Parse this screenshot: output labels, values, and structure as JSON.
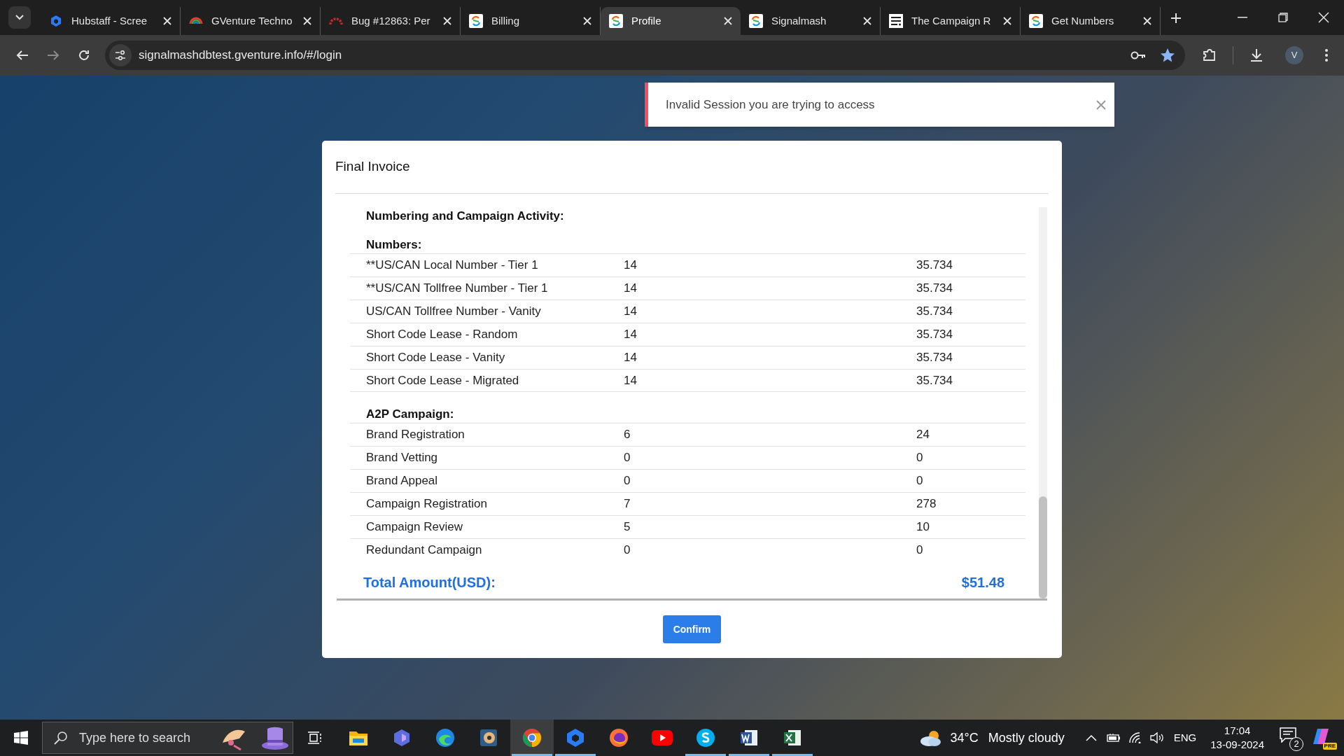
{
  "browser": {
    "tabs": [
      {
        "title": "Hubstaff - Scree",
        "selected": false
      },
      {
        "title": "GVenture Techno",
        "selected": false
      },
      {
        "title": "Bug #12863: Per",
        "selected": false
      },
      {
        "title": "Billing",
        "selected": false
      },
      {
        "title": "Profile",
        "selected": true
      },
      {
        "title": "Signalmash",
        "selected": false
      },
      {
        "title": "The Campaign R",
        "selected": false
      },
      {
        "title": "Get Numbers",
        "selected": false
      }
    ],
    "address": "signalmashdbtest.gventure.info/#/login",
    "bookmarked": true,
    "profile_initial": "V"
  },
  "toast": {
    "message": "Invalid Session you are trying to access"
  },
  "modal": {
    "title": "Final Invoice",
    "heading": "Numbering and Campaign Activity:",
    "sections": [
      {
        "title": "Numbers:",
        "rows": [
          [
            "**US/CAN Local Number - Tier 1",
            "14",
            "35.734"
          ],
          [
            "**US/CAN Tollfree Number - Tier 1",
            "14",
            "35.734"
          ],
          [
            "US/CAN Tollfree Number - Vanity",
            "14",
            "35.734"
          ],
          [
            "Short Code Lease - Random",
            "14",
            "35.734"
          ],
          [
            "Short Code Lease - Vanity",
            "14",
            "35.734"
          ],
          [
            "Short Code Lease - Migrated",
            "14",
            "35.734"
          ]
        ]
      },
      {
        "title": "A2P Campaign:",
        "rows": [
          [
            "Brand Registration",
            "6",
            "24"
          ],
          [
            "Brand Vetting",
            "0",
            "0"
          ],
          [
            "Brand Appeal",
            "0",
            "0"
          ],
          [
            "Campaign Registration",
            "7",
            "278"
          ],
          [
            "Campaign Review",
            "5",
            "10"
          ],
          [
            "Redundant Campaign",
            "0",
            "0"
          ]
        ]
      }
    ],
    "total": {
      "label": "Total Amount(USD):",
      "amount": "$51.48"
    },
    "button": "Confirm"
  },
  "taskbar": {
    "search_placeholder": "Type here to search",
    "apps": [
      {
        "running": false,
        "selected": false
      },
      {
        "running": false,
        "selected": false
      },
      {
        "running": false,
        "selected": false
      },
      {
        "running": false,
        "selected": false
      },
      {
        "running": true,
        "selected": true
      },
      {
        "running": true,
        "selected": false
      },
      {
        "running": false,
        "selected": false
      },
      {
        "running": false,
        "selected": false
      },
      {
        "running": true,
        "selected": false
      },
      {
        "running": true,
        "selected": false
      },
      {
        "running": true,
        "selected": false
      }
    ],
    "weather": {
      "temperature": "34°C",
      "condition": "Mostly cloudy"
    },
    "language": "ENG",
    "time": "17:04",
    "date": "13-09-2024",
    "notifications": "2",
    "copilot_badge": "PRE"
  }
}
